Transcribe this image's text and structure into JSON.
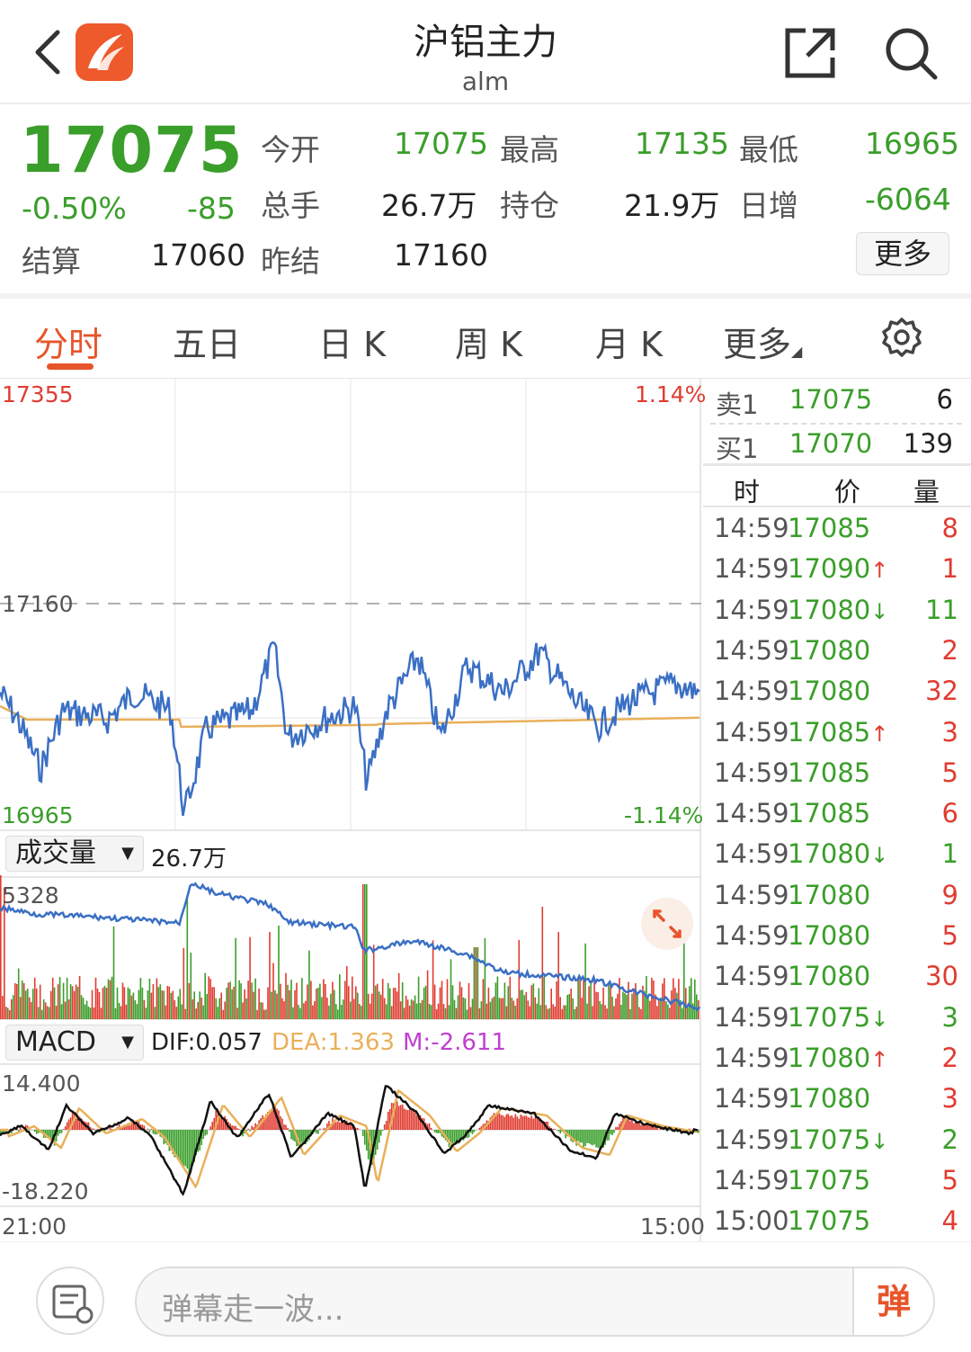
{
  "header": {
    "title": "沪铝主力",
    "code": "alm"
  },
  "quote": {
    "price": "17075",
    "change_pct": "-0.50%",
    "change": "-85",
    "fields": [
      {
        "label": "今开",
        "value": "17075"
      },
      {
        "label": "最高",
        "value": "17135"
      },
      {
        "label": "最低",
        "value": "16965"
      },
      {
        "label": "总手",
        "value": "26.7万"
      },
      {
        "label": "持仓",
        "value": "21.9万"
      },
      {
        "label": "日增",
        "value": "-6064"
      },
      {
        "label": "结算",
        "value": "17060"
      },
      {
        "label": "昨结",
        "value": "17160"
      }
    ],
    "more_label": "更多"
  },
  "tabs": [
    "分时",
    "五日",
    "日 K",
    "周 K",
    "月 K",
    "更多"
  ],
  "chart": {
    "price_high": "17355",
    "price_low": "16965",
    "price_ref": "17160",
    "pct_high": "1.14%",
    "pct_low": "-1.14%",
    "volume_selector": "成交量",
    "volume_total": "26.7万",
    "volume_max": "5328",
    "macd_selector": "MACD",
    "dif": "DIF:0.057",
    "dea": "DEA:1.363",
    "m": "M:-2.611",
    "macd_max": "14.400",
    "macd_min": "-18.220",
    "time_start": "21:00",
    "time_end": "15:00",
    "colors": {
      "price_line": "#3a6fc4",
      "avg_line": "#e9b05a",
      "up": "#e03c31",
      "down": "#3a9e2a",
      "dea": "#e9b05a",
      "m": "#c040d0"
    }
  },
  "orderbook": {
    "sell": {
      "label": "卖1",
      "price": "17075",
      "vol": "6"
    },
    "buy": {
      "label": "买1",
      "price": "17070",
      "vol": "139"
    }
  },
  "ticks_header": {
    "time": "时",
    "price": "价",
    "vol": "量"
  },
  "ticks": [
    {
      "time": "14:59",
      "price": "17085",
      "arrow": "",
      "vol": "8",
      "dir": "up"
    },
    {
      "time": "14:59",
      "price": "17090",
      "arrow": "↑",
      "vol": "1",
      "dir": "up"
    },
    {
      "time": "14:59",
      "price": "17080",
      "arrow": "↓",
      "vol": "11",
      "dir": "down"
    },
    {
      "time": "14:59",
      "price": "17080",
      "arrow": "",
      "vol": "2",
      "dir": "up"
    },
    {
      "time": "14:59",
      "price": "17080",
      "arrow": "",
      "vol": "32",
      "dir": "up"
    },
    {
      "time": "14:59",
      "price": "17085",
      "arrow": "↑",
      "vol": "3",
      "dir": "up"
    },
    {
      "time": "14:59",
      "price": "17085",
      "arrow": "",
      "vol": "5",
      "dir": "up"
    },
    {
      "time": "14:59",
      "price": "17085",
      "arrow": "",
      "vol": "6",
      "dir": "up"
    },
    {
      "time": "14:59",
      "price": "17080",
      "arrow": "↓",
      "vol": "1",
      "dir": "down"
    },
    {
      "time": "14:59",
      "price": "17080",
      "arrow": "",
      "vol": "9",
      "dir": "up"
    },
    {
      "time": "14:59",
      "price": "17080",
      "arrow": "",
      "vol": "5",
      "dir": "up"
    },
    {
      "time": "14:59",
      "price": "17080",
      "arrow": "",
      "vol": "30",
      "dir": "up"
    },
    {
      "time": "14:59",
      "price": "17075",
      "arrow": "↓",
      "vol": "3",
      "dir": "down"
    },
    {
      "time": "14:59",
      "price": "17080",
      "arrow": "↑",
      "vol": "2",
      "dir": "up"
    },
    {
      "time": "14:59",
      "price": "17080",
      "arrow": "",
      "vol": "3",
      "dir": "up"
    },
    {
      "time": "14:59",
      "price": "17075",
      "arrow": "↓",
      "vol": "2",
      "dir": "down"
    },
    {
      "time": "14:59",
      "price": "17075",
      "arrow": "",
      "vol": "5",
      "dir": "up"
    },
    {
      "time": "15:00",
      "price": "17075",
      "arrow": "",
      "vol": "4",
      "dir": "up"
    }
  ],
  "danmu": {
    "placeholder": "弹幕走一波...",
    "button": "弹"
  }
}
